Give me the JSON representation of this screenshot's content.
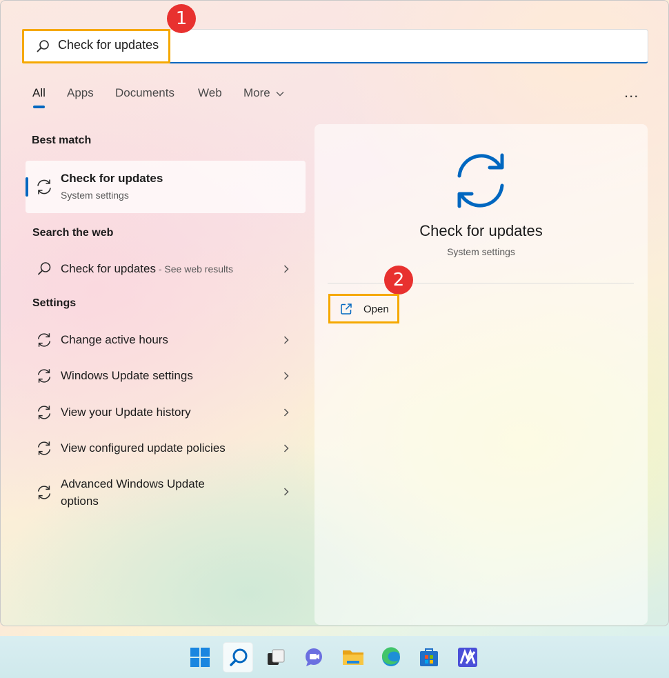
{
  "search": {
    "value": "Check for updates",
    "callout_1": "1"
  },
  "tabs": {
    "all": "All",
    "apps": "Apps",
    "documents": "Documents",
    "web": "Web",
    "more": "More",
    "overflow": "..."
  },
  "best_match": {
    "heading": "Best match",
    "title": "Check for updates",
    "subtitle": "System settings"
  },
  "web_section": {
    "heading": "Search the web",
    "item_label": "Check for updates",
    "item_suffix": " - See web results"
  },
  "settings_section": {
    "heading": "Settings",
    "items": [
      {
        "label": "Change active hours"
      },
      {
        "label": "Windows Update settings"
      },
      {
        "label": "View your Update history"
      },
      {
        "label": "View configured update policies"
      },
      {
        "label": "Advanced Windows Update",
        "label2": "options"
      }
    ]
  },
  "preview": {
    "title": "Check for updates",
    "subtitle": "System settings",
    "open_label": "Open",
    "callout_2": "2"
  },
  "taskbar": {
    "icons": [
      "windows-start-icon",
      "search-icon",
      "task-view-icon",
      "chat-icon",
      "file-explorer-icon",
      "edge-icon",
      "store-icon",
      "app-icon"
    ]
  },
  "colors": {
    "accent": "#0067c0",
    "highlight": "#f5a800",
    "badge": "#e8312f"
  }
}
